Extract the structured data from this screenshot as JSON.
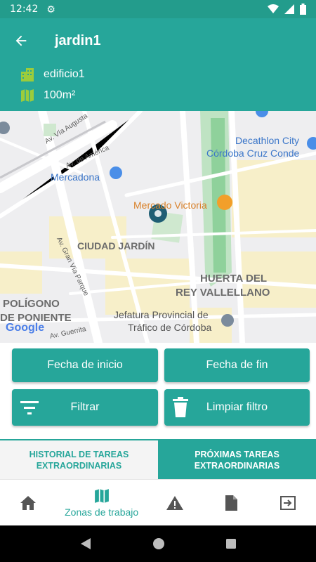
{
  "status_bar": {
    "time": "12:42"
  },
  "app_bar": {
    "title": "jardin1"
  },
  "info": {
    "building": "edificio1",
    "area": "100m²"
  },
  "map": {
    "labels": {
      "decathlon1": "Decathlon City",
      "decathlon2": "Córdoba Cruz Conde",
      "mercadona": "Mercadona",
      "mercado": "Mercado Victoria",
      "ciudad": "CIUDAD JARDÍN",
      "huerta1": "HUERTA DEL",
      "huerta2": "REY VALLELLANO",
      "poligono1": "POLÍGONO",
      "poligono2": "DE PONIENTE",
      "jefatura1": "Jefatura Provincial de",
      "jefatura2": "Tráfico de Córdoba",
      "via_augusta": "Av. Vía Augusta",
      "america": "Av. de América",
      "gran_via": "Av. Gran Vía Parque",
      "guerrita": "Av. Guerrita",
      "google": "Google"
    }
  },
  "buttons": {
    "start_date": "Fecha de inicio",
    "end_date": "Fecha de fin",
    "filter": "Filtrar",
    "clear_filter": "Limpiar filtro"
  },
  "tabs": {
    "history": "HISTORIAL DE TAREAS EXTRAORDINARIAS",
    "upcoming": "PRÓXIMAS TAREAS EXTRAORDINARIAS"
  },
  "bottom_nav": {
    "home": "home-icon",
    "zones": "Zonas de trabajo",
    "alerts": "warning-icon",
    "docs": "document-icon",
    "exit": "logout-icon"
  },
  "colors": {
    "primary": "#26a69a",
    "status": "#239c8c",
    "accent_icon": "#9ccc3c"
  }
}
